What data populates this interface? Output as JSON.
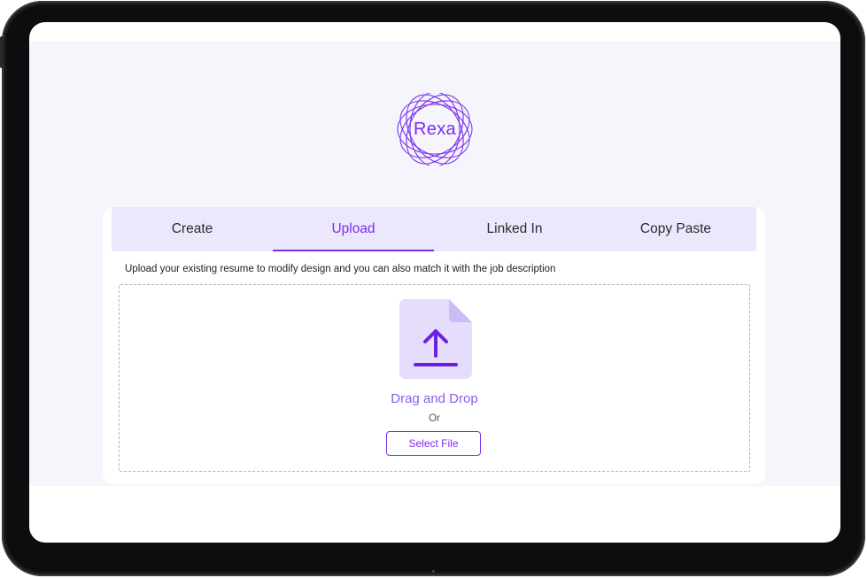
{
  "brand": {
    "logo_text": "Rexa",
    "accent_color": "#7b2ff0"
  },
  "tabs": [
    {
      "label": "Create",
      "active": false
    },
    {
      "label": "Upload",
      "active": true
    },
    {
      "label": "Linked In",
      "active": false
    },
    {
      "label": "Copy Paste",
      "active": false
    }
  ],
  "upload": {
    "description": "Upload your existing resume to modify design and you can also match it with the job description",
    "icon": "file-upload-icon",
    "drag_text": "Drag and Drop",
    "or_text": "Or",
    "select_button": "Select File"
  },
  "colors": {
    "tab_bar_bg": "#ede7fd",
    "page_bg": "#f5f5fb",
    "file_icon_bg": "#e6dcfc"
  }
}
